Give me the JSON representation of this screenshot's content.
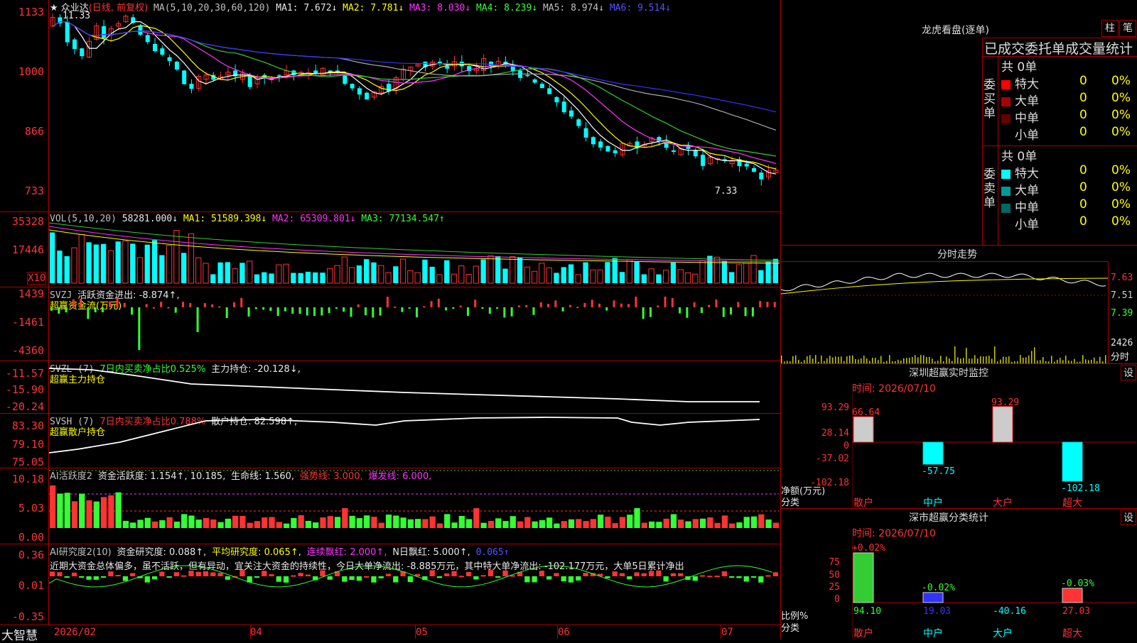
{
  "main": {
    "title": "★ 众业达",
    "mode": "(日线, 前复权)",
    "ma_prefix": "MA(5,10,20,30,60,120)",
    "ma1": "MA1: 7.672↓",
    "ma2": "MA2: 7.781↓",
    "ma3": "MA3: 8.030↓",
    "ma4": "MA4: 8.239↓",
    "ma5": "MA5: 8.974↓",
    "ma6": "MA6: 9.514↓",
    "high_label": "11.33",
    "low_label": "7.33",
    "y_ticks": [
      "1133",
      "1000",
      "866",
      "733"
    ],
    "colors": {
      "up": "#ff3333",
      "down": "#00ffff",
      "ma1": "#ffffff",
      "ma2": "#ffff00",
      "ma3": "#ff33ff",
      "ma4": "#33cc33",
      "ma5": "#aaaaaa",
      "ma6": "#3333ff"
    }
  },
  "vol": {
    "prefix": "VOL(5,10,20)",
    "val": "58281.000↓",
    "ma1": "MA1: 51589.398↓",
    "ma2": "MA2: 65309.801↓",
    "ma3": "MA3: 77134.547↑",
    "y_ticks": [
      "35328",
      "17446",
      "X10"
    ]
  },
  "svzj": {
    "prefix": "SVZJ",
    "text": "活跃资金进出: -8.874↑,",
    "subtitle": "超赢资金流(万元)",
    "y_ticks": [
      "1439",
      "-1461",
      "-4360"
    ]
  },
  "svzl": {
    "prefix": "SVZL (7)",
    "ratio": "7日内买卖净占比0.525%",
    "text": "主力持仓: -20.128↓,",
    "subtitle": "超赢主力持仓",
    "y_ticks": [
      "-11.57",
      "-15.90",
      "-20.24"
    ]
  },
  "svsh": {
    "prefix": "SVSH (7)",
    "ratio": "7日内买卖净占比0.788%",
    "text": "散户持仓: 82.598↑,",
    "subtitle": "超赢散户持仓",
    "y_ticks": [
      "83.30",
      "79.10",
      "75.05"
    ]
  },
  "ai1": {
    "prefix": "AI活跃度2",
    "text1": "资金活跃度: 1.154↑, 10.185,",
    "text2": "生命线: 1.560,",
    "strong": "强势线: 3.000,",
    "burst": "爆发线: 6.000,",
    "y_ticks": [
      "10.18",
      "5.03",
      "0.00"
    ]
  },
  "ai2": {
    "prefix": "AI研究度2(10)",
    "text1": "资金研究度: 0.088↑,",
    "avg": "平均研究度: 0.065↑,",
    "cont": "连续飘红: 2.000↑,",
    "n": "N日飘红: 5.000↑,",
    "last": "0.065↑",
    "comment": "近期大资金总体偏多，虽不活跃，但有异动，宜关注大资金的持续性，今日大单净流出: -8.885万元，其中特大单净流出: -102.177万元，大单5日累计净出",
    "y_ticks": [
      "0.36",
      "0.01",
      "-0.35"
    ]
  },
  "xaxis": {
    "brand": "大智慧",
    "labels": [
      "2026/02",
      "04",
      "05",
      "06",
      "07"
    ]
  },
  "lhb": {
    "title": "龙虎看盘(逐单)",
    "btn1": "柱",
    "btn2": "笔",
    "header": "已成交委托单成交量统计",
    "buy_label": "委买单",
    "sell_label": "委卖单",
    "buy_total": "共 0单",
    "sell_total": "共 0单",
    "buy_rows": [
      {
        "name": "特大",
        "count": "0",
        "pct": "0%",
        "color": "#ff0000"
      },
      {
        "name": "大单",
        "count": "0",
        "pct": "0%",
        "color": "#aa0000"
      },
      {
        "name": "中单",
        "count": "0",
        "pct": "0%",
        "color": "#660000"
      },
      {
        "name": "小单",
        "count": "0",
        "pct": "0%",
        "color": ""
      }
    ],
    "sell_rows": [
      {
        "name": "特大",
        "count": "0",
        "pct": "0%",
        "color": "#00ffff"
      },
      {
        "name": "大单",
        "count": "0",
        "pct": "0%",
        "color": "#009999"
      },
      {
        "name": "中单",
        "count": "0",
        "pct": "0%",
        "color": "#006666"
      },
      {
        "name": "小单",
        "count": "0",
        "pct": "0%",
        "color": ""
      }
    ]
  },
  "intraday": {
    "title": "分时走势",
    "p1": "7.63",
    "p2": "7.51",
    "p3": "7.39",
    "vol": "2426",
    "unit": "分时"
  },
  "sz_monitor": {
    "title": "深圳超赢实时监控",
    "btn": "设",
    "date": "时间: 2026/07/10",
    "y_ticks": [
      "93.29",
      "28.14",
      "0",
      "-37.02",
      "-102.18"
    ],
    "label1": "净额(万元)",
    "label2": "分类",
    "bars": [
      {
        "name": "散户",
        "value": 66.64,
        "label": "66.64"
      },
      {
        "name": "中户",
        "value": -57.75,
        "label": "-57.75"
      },
      {
        "name": "大户",
        "value": 93.29,
        "label": "93.29"
      },
      {
        "name": "超大",
        "value": -102.18,
        "label": "-102.18"
      }
    ]
  },
  "sz_stats": {
    "title": "深市超赢分类统计",
    "btn": "设",
    "date": "时间: 2026/07/10",
    "y_ticks": [
      "75",
      "50",
      "25",
      "0"
    ],
    "label1": "比例%",
    "label2": "分类",
    "bars": [
      {
        "name": "散户",
        "top": "+0.02%",
        "bottom": "94.10",
        "value": 94.1
      },
      {
        "name": "中户",
        "top": "-0.02%",
        "bottom": "19.03",
        "value": 19.03
      },
      {
        "name": "大户",
        "top": "",
        "bottom": "-40.16",
        "value": 0
      },
      {
        "name": "超大",
        "top": "-0.03%",
        "bottom": "27.03",
        "value": 27.03
      }
    ]
  }
}
